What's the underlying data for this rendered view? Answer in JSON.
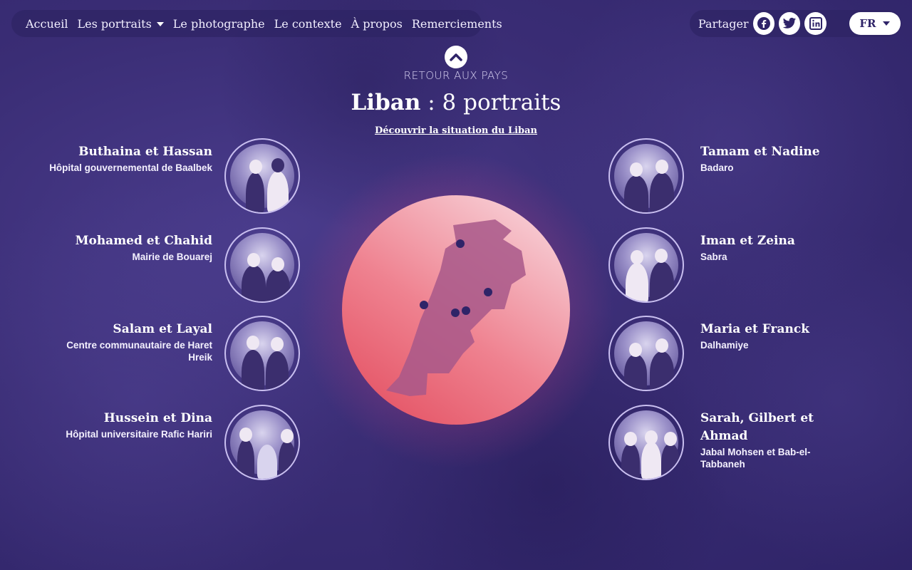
{
  "nav": {
    "items": [
      "Accueil",
      "Les portraits",
      "Le photographe",
      "Le contexte",
      "À propos",
      "Remerciements"
    ],
    "share_label": "Partager",
    "social": [
      "facebook-icon",
      "twitter-icon",
      "linkedin-icon"
    ],
    "lang": "FR"
  },
  "hero": {
    "back_label": "RETOUR AUX PAYS",
    "country": "Liban",
    "count_text": " : 8 portraits",
    "discover_link": "Découvrir la situation du Liban"
  },
  "portraits_left": [
    {
      "name": "Buthaina et Hassan",
      "place": "Hôpital gouvernemental de Baalbek"
    },
    {
      "name": "Mohamed et Chahid",
      "place": "Mairie de Bouarej"
    },
    {
      "name": "Salam et Layal",
      "place": "Centre communautaire de Haret Hreik"
    },
    {
      "name": "Hussein et Dina",
      "place": "Hôpital universitaire Rafic Hariri"
    }
  ],
  "portraits_right": [
    {
      "name": "Tamam et Nadine",
      "place": "Badaro"
    },
    {
      "name": "Iman et Zeina",
      "place": "Sabra"
    },
    {
      "name": "Maria et Franck",
      "place": "Dalhamiye"
    },
    {
      "name": "Sarah, Gilbert et Ahmad",
      "place": "Jabal Mohsen et Bab-el-Tabbaneh"
    }
  ],
  "colors": {
    "background": "#3a2d75",
    "accent": "#e24a5c",
    "map_fill": "#a8588a",
    "marker": "#2f2468"
  }
}
